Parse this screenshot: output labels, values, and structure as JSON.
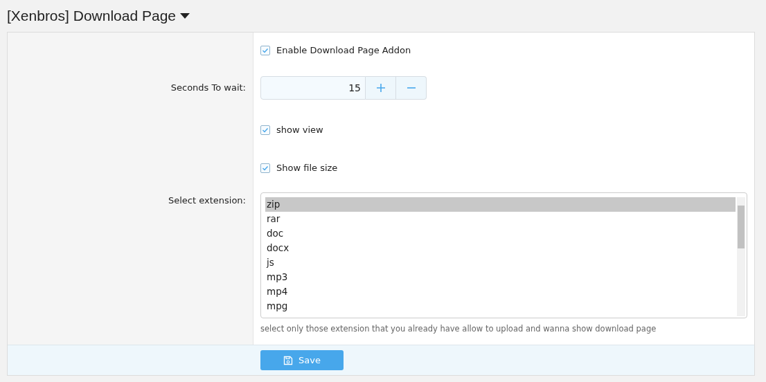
{
  "title": "[Xenbros] Download Page",
  "fields": [
    {
      "kind": "checkbox",
      "label": "Enable Download Page Addon",
      "checked": true
    },
    {
      "kind": "number",
      "label": "Seconds To wait:",
      "value": "15"
    },
    {
      "kind": "checkbox",
      "label": "show view",
      "checked": true
    },
    {
      "kind": "checkbox",
      "label": "Show file size",
      "checked": true
    },
    {
      "kind": "listbox",
      "label": "Select extension:",
      "options": [
        {
          "text": "zip",
          "selected": true
        },
        {
          "text": "rar",
          "selected": false
        },
        {
          "text": "doc",
          "selected": false
        },
        {
          "text": "docx",
          "selected": false
        },
        {
          "text": "js",
          "selected": false
        },
        {
          "text": "mp3",
          "selected": false
        },
        {
          "text": "mp4",
          "selected": false
        },
        {
          "text": "mpg",
          "selected": false
        }
      ],
      "explain": "select only those extension that you already have allow to upload and wanna show download page"
    }
  ],
  "save_button": "Save"
}
